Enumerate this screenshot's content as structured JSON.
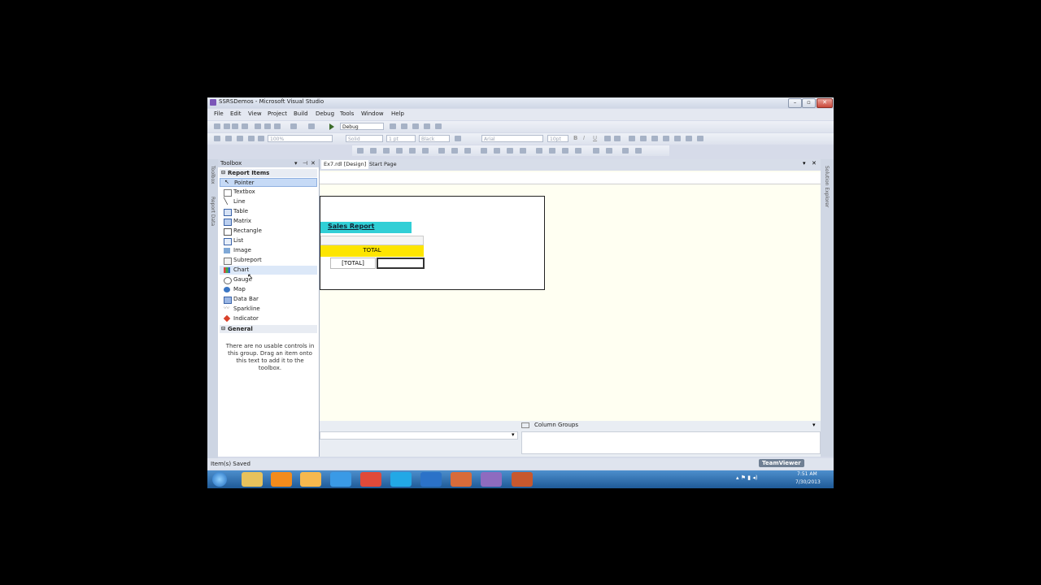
{
  "window": {
    "title": "SSRSDemos - Microsoft Visual Studio"
  },
  "menu": [
    "File",
    "Edit",
    "View",
    "Project",
    "Build",
    "Debug",
    "Tools",
    "Window",
    "Help"
  ],
  "toolbar": {
    "config": "Debug",
    "zoom": "100%",
    "border_style": "Solid",
    "border_width": "1 pt",
    "border_color": "Black",
    "font": "Arial",
    "font_size": "10pt"
  },
  "left_strip": {
    "toolbox_label": "Toolbox",
    "report_data_label": "Report Data"
  },
  "right_strip": {
    "solution_explorer_label": "Solution Explorer"
  },
  "toolbox": {
    "title": "Toolbox",
    "group_report_items": "Report Items",
    "items": [
      "Pointer",
      "Textbox",
      "Line",
      "Table",
      "Matrix",
      "Rectangle",
      "List",
      "Image",
      "Subreport",
      "Chart",
      "Gauge",
      "Map",
      "Data Bar",
      "Sparkline",
      "Indicator"
    ],
    "group_general": "General",
    "general_help": "There are no usable controls in this group. Drag an item onto this text to add it to the toolbox."
  },
  "tabs": [
    "Ex7.rdl [Design]",
    "Start Page"
  ],
  "report": {
    "title": "Sales Report",
    "header_cell": "TOTAL",
    "data_cell": "[TOTAL]"
  },
  "groups": {
    "column_groups_label": "Column Groups"
  },
  "status": {
    "text": "Item(s) Saved"
  },
  "taskbar": {
    "time": "7:51 AM",
    "date": "7/30/2013",
    "watermark": "TeamViewer"
  },
  "colors": {
    "title_band": "#31cfd6",
    "total_band": "#fde500",
    "selection": "#c6daf6"
  }
}
